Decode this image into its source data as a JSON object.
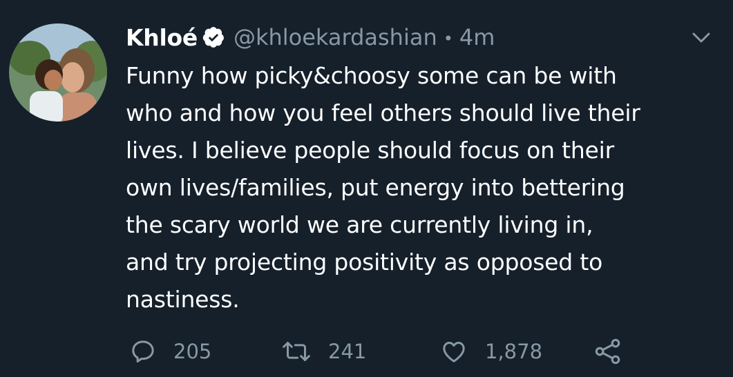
{
  "user": {
    "display_name": "Khloé",
    "handle": "@khloekardashian",
    "separator": "•",
    "time": "4m",
    "verified": true
  },
  "tweet": {
    "text": "Funny how picky&choosy some can be with\nwho and how you feel others should live their\nlives. I believe people should focus on their\nown lives/families, put energy into bettering\nthe scary world we are currently living in,\nand try projecting positivity as opposed to\nnastiness."
  },
  "actions": {
    "reply_count": "205",
    "retweet_count": "241",
    "like_count": "1,878"
  },
  "icons": {
    "verified": "verified-badge-icon",
    "caret": "chevron-down-icon",
    "reply": "reply-icon",
    "retweet": "retweet-icon",
    "like": "heart-icon",
    "share": "share-icon"
  },
  "colors": {
    "background": "#15202b",
    "text": "#ffffff",
    "secondary": "#8899a6"
  }
}
